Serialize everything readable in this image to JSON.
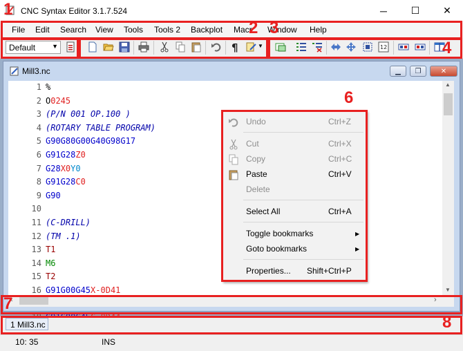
{
  "window": {
    "title": "CNC Syntax Editor 3.1.7.524",
    "minimize": "─",
    "maximize": "☐",
    "close": "✕"
  },
  "menu": [
    "File",
    "Edit",
    "Search",
    "View",
    "Tools",
    "Tools 2",
    "Backplot",
    "Macr",
    "Window",
    "Help"
  ],
  "toolbar": {
    "profile_value": "Default",
    "icons": [
      "settings-icon",
      "new-file-icon",
      "open-folder-icon",
      "save-icon",
      "print-icon",
      "cut-icon",
      "copy-icon",
      "paste-icon",
      "undo-icon",
      "pilcrow-icon",
      "format-icon",
      "outline-icon",
      "numbered-list-icon",
      "renumber-icon",
      "arrows-horizontal-icon",
      "arrows-all-icon",
      "select-block-icon",
      "numbering-icon",
      "convert-icon",
      "convert2-icon",
      "split-icon"
    ]
  },
  "document": {
    "title": "Mill3.nc",
    "lines": [
      {
        "n": "1",
        "segs": [
          {
            "t": "%",
            "c": "blk"
          }
        ]
      },
      {
        "n": "2",
        "segs": [
          {
            "t": "O",
            "c": "blk"
          },
          {
            "t": "0245",
            "c": "red"
          }
        ]
      },
      {
        "n": "3",
        "segs": [
          {
            "t": "(P/N 001 OP.100 )",
            "c": "navy"
          }
        ]
      },
      {
        "n": "4",
        "segs": [
          {
            "t": "(ROTARY TABLE PROGRAM)",
            "c": "navy"
          }
        ]
      },
      {
        "n": "5",
        "segs": [
          {
            "t": "G90G80G00G40G98G17",
            "c": "blue"
          }
        ]
      },
      {
        "n": "6",
        "segs": [
          {
            "t": "G91G28",
            "c": "blue"
          },
          {
            "t": "Z0",
            "c": "red"
          }
        ]
      },
      {
        "n": "7",
        "segs": [
          {
            "t": "G28",
            "c": "blue"
          },
          {
            "t": "X0",
            "c": "red"
          },
          {
            "t": "Y0",
            "c": "cyan"
          }
        ]
      },
      {
        "n": "8",
        "segs": [
          {
            "t": "G91G28",
            "c": "blue"
          },
          {
            "t": "C0",
            "c": "red"
          }
        ]
      },
      {
        "n": "9",
        "segs": [
          {
            "t": "G90",
            "c": "blue"
          }
        ]
      },
      {
        "n": "10",
        "segs": []
      },
      {
        "n": "11",
        "segs": [
          {
            "t": "(C-DRILL)",
            "c": "navy"
          }
        ]
      },
      {
        "n": "12",
        "segs": [
          {
            "t": "(TM .1)",
            "c": "navy"
          }
        ]
      },
      {
        "n": "13",
        "segs": [
          {
            "t": "T1",
            "c": "darkred"
          }
        ]
      },
      {
        "n": "14",
        "segs": [
          {
            "t": "M6",
            "c": "green"
          }
        ]
      },
      {
        "n": "15",
        "segs": [
          {
            "t": "T2",
            "c": "darkred"
          }
        ]
      },
      {
        "n": "16",
        "segs": [
          {
            "t": "G91G00G45",
            "c": "blue"
          },
          {
            "t": "X-0",
            "c": "red"
          },
          {
            "t": "D41",
            "c": "red"
          }
        ]
      },
      {
        "n": "17",
        "segs": [
          {
            "t": "G91G00G45",
            "c": "blue"
          },
          {
            "t": "Y-0",
            "c": "cyan"
          },
          {
            "t": "D42",
            "c": "red"
          }
        ]
      },
      {
        "n": "18",
        "segs": [
          {
            "t": "G91G00G45",
            "c": "blue"
          },
          {
            "t": "C-0",
            "c": "red"
          },
          {
            "t": "D44",
            "c": "red"
          }
        ]
      }
    ]
  },
  "context_menu": {
    "items": [
      {
        "label": "Undo",
        "key": "Ctrl+Z",
        "disabled": true
      },
      {
        "label": "Cut",
        "key": "Ctrl+X",
        "disabled": true
      },
      {
        "label": "Copy",
        "key": "Ctrl+C",
        "disabled": true
      },
      {
        "label": "Paste",
        "key": "Ctrl+V",
        "disabled": false
      },
      {
        "label": "Delete",
        "key": "",
        "disabled": true
      },
      {
        "label": "Select All",
        "key": "Ctrl+A",
        "disabled": false
      },
      {
        "label": "Toggle bookmarks",
        "key": "",
        "disabled": false,
        "submenu": true
      },
      {
        "label": "Goto bookmarks",
        "key": "",
        "disabled": false,
        "submenu": true
      },
      {
        "label": "Properties...",
        "key": "Shift+Ctrl+P",
        "disabled": false
      }
    ]
  },
  "tabs": [
    {
      "label": "1 Mill3.nc"
    }
  ],
  "status": {
    "position": "10: 35",
    "mode": "INS"
  },
  "annotations": [
    "1",
    "2",
    "3",
    "4",
    "6",
    "7",
    "8"
  ],
  "colors": {
    "annotation": "#e82020",
    "mdi_background": "#9aaec8"
  }
}
